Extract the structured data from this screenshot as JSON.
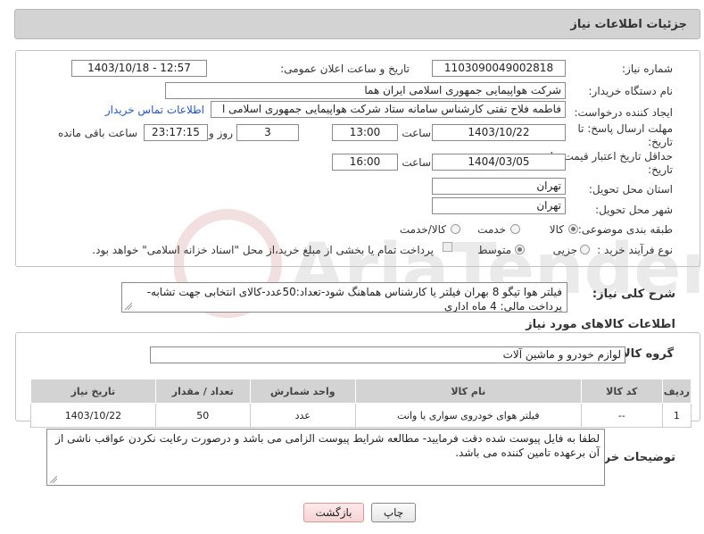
{
  "header": {
    "title": "جزئیات اطلاعات نیاز"
  },
  "form": {
    "need_number_label": "شماره نیاز:",
    "need_number": "1103090049002818",
    "announce_datetime_label": "تاریخ و ساعت اعلان عمومی:",
    "announce_datetime": "1403/10/18 - 12:57",
    "buyer_org_label": "نام دستگاه خریدار:",
    "buyer_org": "شرکت هواپیمایی جمهوری اسلامی ایران هما",
    "requester_label": "ایجاد کننده درخواست:",
    "requester": "فاطمه فلاح تفتی کارشناس سامانه ستاد شرکت هواپیمایی جمهوری اسلامی ا",
    "contact_link": "اطلاعات تماس خریدار",
    "deadline_label_1": "مهلت ارسال پاسخ: تا",
    "deadline_label_2": "تاریخ:",
    "deadline_date": "1403/10/22",
    "time_label": "ساعت",
    "deadline_time": "13:00",
    "days_value": "3",
    "days_label": "روز و",
    "remaining_time": "23:17:15",
    "remaining_label": "ساعت باقی مانده",
    "validity_label_1": "حداقل تاریخ اعتبار قیمت: تا",
    "validity_label_2": "تاریخ:",
    "validity_date": "1404/03/05",
    "validity_time_label": "ساعت",
    "validity_time": "16:00",
    "province_label": "استان محل تحویل:",
    "province": "تهران",
    "city_label": "شهر محل تحویل:",
    "city": "تهران",
    "category_label": "طبقه بندی موضوعی:",
    "category_options": [
      "کالا",
      "خدمت",
      "کالا/خدمت"
    ],
    "process_label": "نوع فرآیند خرید :",
    "process_options": [
      "جزیی",
      "متوسط"
    ],
    "payment_note": "پرداخت تمام یا بخشی از مبلغ خرید،از محل \"اسناد خزانه اسلامی\" خواهد بود."
  },
  "description": {
    "label": "شرح کلی نیاز:",
    "text": "فیلتر هوا تیگو 8 بهران فیلتر یا کارشناس هماهنگ شود-تعداد:50عدد-کالای انتخابی جهت تشابه- پرداخت مالی: 4 ماه اداری"
  },
  "goods": {
    "section_title": "اطلاعات کالاهای مورد نیاز",
    "group_label": "گروه کالا:",
    "group_value": "لوازم خودرو و ماشین آلات",
    "columns": [
      "ردیف",
      "کد کالا",
      "نام کالا",
      "واحد شمارش",
      "تعداد / مقدار",
      "تاریخ نیاز"
    ],
    "rows": [
      [
        "1",
        "--",
        "فیلتر هوای خودروی سواری یا وانت",
        "عدد",
        "50",
        "1403/10/22"
      ]
    ]
  },
  "buyer_notes": {
    "label": "توضیحات خریدار:",
    "text": "لطفا به فایل پیوست شده دقت فرمایید- مطالعه شرایط پیوست الزامی می باشد و درصورت رعایت نکردن عواقب ناشی از آن برعهده تامین کننده می باشد."
  },
  "buttons": {
    "print": "چاپ",
    "back": "بازگشت"
  },
  "watermark": {
    "text": "AriaTender.neT"
  },
  "colors": {
    "header_bg": "#d3d3d3",
    "link": "#2255cc",
    "back_button": "#f6d3d5",
    "watermark": "#e8c9c9"
  }
}
